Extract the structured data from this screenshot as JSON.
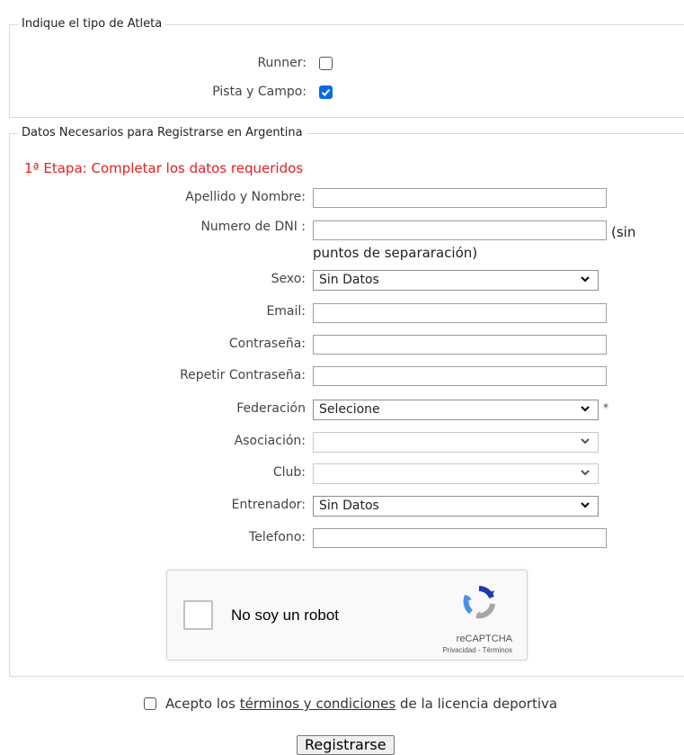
{
  "athlete_type": {
    "legend": "Indique el tipo de Atleta",
    "runner_label": "Runner:",
    "runner_checked": false,
    "track_label": "Pista y Campo:",
    "track_checked": true
  },
  "registration": {
    "legend": "Datos Necesarios para Registrarse en Argentina",
    "stage_text": "1ª Etapa: Completar los datos  requeridos",
    "fields": {
      "name_label": "Apellido y Nombre:",
      "name_value": "",
      "dni_label": "Numero de DNI :",
      "dni_value": "",
      "dni_note_a": "(sin",
      "dni_note_b": "puntos de separaración)",
      "sex_label": "Sexo:",
      "sex_value": "Sin Datos",
      "email_label": "Email:",
      "email_value": "",
      "password_label": "Contraseña:",
      "repeat_password_label": "Repetir Contraseña:",
      "federation_label": "Federación",
      "federation_value": "Selecione",
      "federation_required": "*",
      "association_label": "Asociación:",
      "association_value": "",
      "club_label": "Club:",
      "club_value": "",
      "coach_label": "Entrenador:",
      "coach_value": "Sin Datos",
      "phone_label": "Telefono:",
      "phone_value": ""
    },
    "captcha": {
      "label": "No soy un robot",
      "brand": "reCAPTCHA",
      "links": "Privacidad - Términos"
    }
  },
  "terms": {
    "prefix": "Acepto los ",
    "link": "términos y condiciones",
    "suffix": " de la licencia deportiva",
    "checked": false
  },
  "submit_label": "Registrarse",
  "colors": {
    "accent": "#0b6ae0",
    "warning": "#e62020"
  }
}
